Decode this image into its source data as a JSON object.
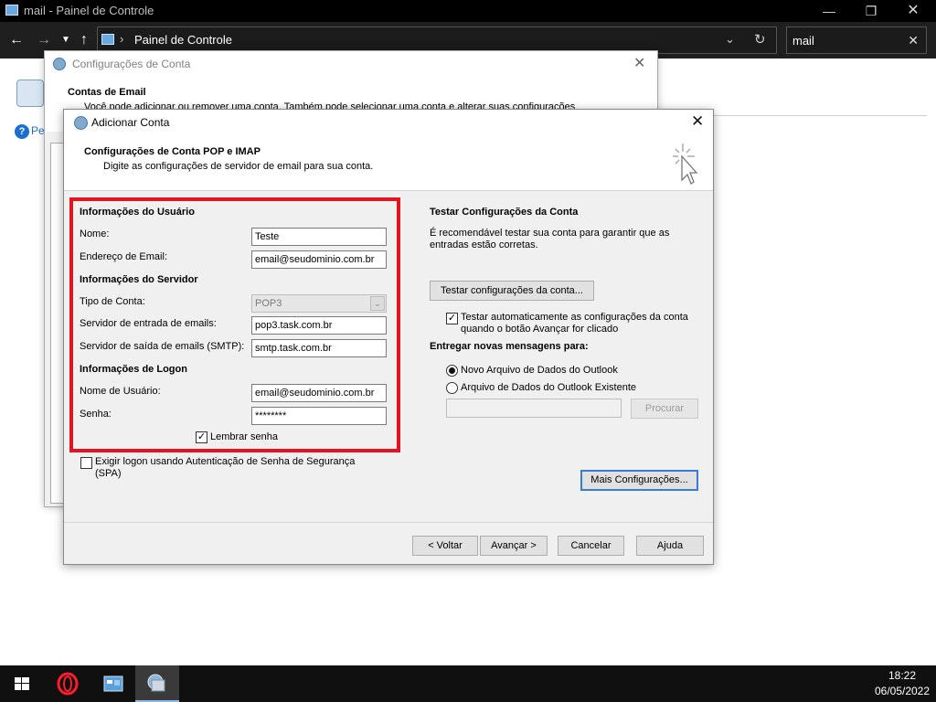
{
  "control_panel": {
    "window_title": "mail - Painel de Controle",
    "address_path": "Painel de Controle",
    "search_value": "mail",
    "left_help_text": "Pes"
  },
  "account_settings": {
    "title": "Configurações de Conta",
    "header": "Contas de Email",
    "description": "Você pode adicionar ou remover uma conta. Também pode selecionar uma conta e alterar suas configurações"
  },
  "dialog": {
    "title": "Adicionar Conta",
    "header_title": "Configurações de Conta POP e IMAP",
    "header_desc": "Digite as configurações de servidor de email para sua conta.",
    "user_info": {
      "section": "Informações do Usuário",
      "name_label": "Nome:",
      "name_value": "Teste",
      "email_label": "Endereço de Email:",
      "email_value": "email@seudominio.com.br"
    },
    "server_info": {
      "section": "Informações do Servidor",
      "account_type_label": "Tipo de Conta:",
      "account_type_value": "POP3",
      "incoming_label": "Servidor de entrada de emails:",
      "incoming_value": "pop3.task.com.br",
      "outgoing_label": "Servidor de saída de emails (SMTP):",
      "outgoing_value": "smtp.task.com.br"
    },
    "logon_info": {
      "section": "Informações de Logon",
      "username_label": "Nome de Usuário:",
      "username_value": "email@seudominio.com.br",
      "password_label": "Senha:",
      "password_value": "********",
      "remember_label": "Lembrar senha",
      "remember_checked": true
    },
    "spa_label": "Exigir logon usando Autenticação de Senha de Segurança (SPA)",
    "spa_checked": false,
    "test": {
      "section": "Testar Configurações da Conta",
      "desc": "É recomendável testar sua conta para garantir que as entradas estão corretas.",
      "test_button": "Testar configurações da conta...",
      "auto_test_label": "Testar automaticamente as configurações da conta quando o botão Avançar for clicado",
      "auto_test_checked": true
    },
    "deliver": {
      "section": "Entregar novas mensagens para:",
      "option_new": "Novo Arquivo de Dados do Outlook",
      "option_existing": "Arquivo de Dados do Outlook Existente",
      "selected": "new",
      "browse_button": "Procurar"
    },
    "more_settings_button": "Mais Configurações...",
    "footer": {
      "back": "< Voltar",
      "next": "Avançar >",
      "cancel": "Cancelar",
      "help": "Ajuda"
    }
  },
  "taskbar": {
    "time": "18:22",
    "date": "06/05/2022"
  }
}
